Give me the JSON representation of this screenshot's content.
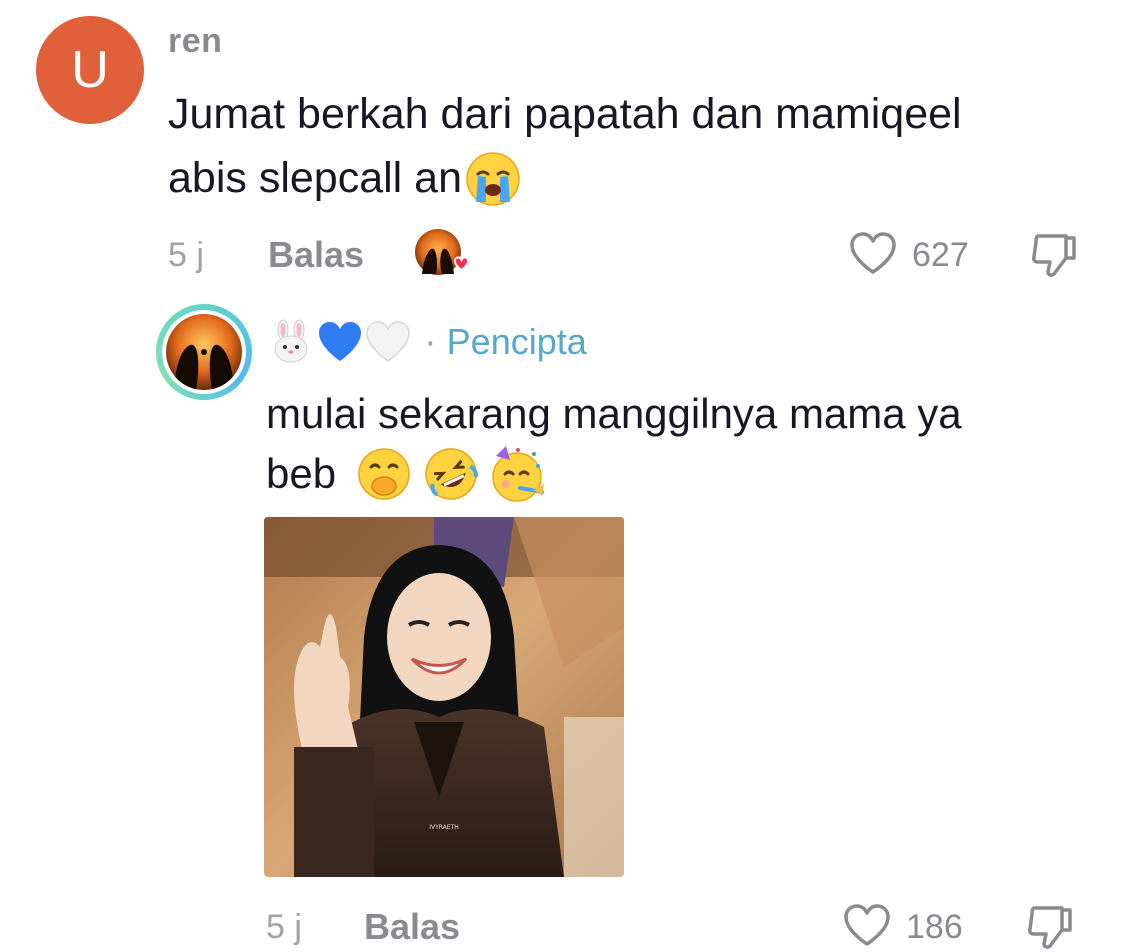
{
  "comment": {
    "avatar_letter": "U",
    "username": "ren",
    "text_line1": "Jumat berkah dari papatah dan mamiqeel",
    "text_line2": "abis slepcall an",
    "time": "5 j",
    "reply_label": "Balas",
    "like_count": "627",
    "creator_liked": true
  },
  "reply": {
    "name_emojis": "🐰💙🤍",
    "separator": "·",
    "creator_label": "Pencipta",
    "text_line1": "mulai sekarang manggilnya mama ya",
    "text_line2": "beb",
    "gif_watermark": "IVYRAETH",
    "time": "5 j",
    "reply_label": "Balas",
    "like_count": "186"
  },
  "colors": {
    "avatar_bg": "#e0603a",
    "creator_accent": "#58a6c8",
    "liked_heart": "#fe2c55",
    "muted_text": "#8a8b91"
  }
}
